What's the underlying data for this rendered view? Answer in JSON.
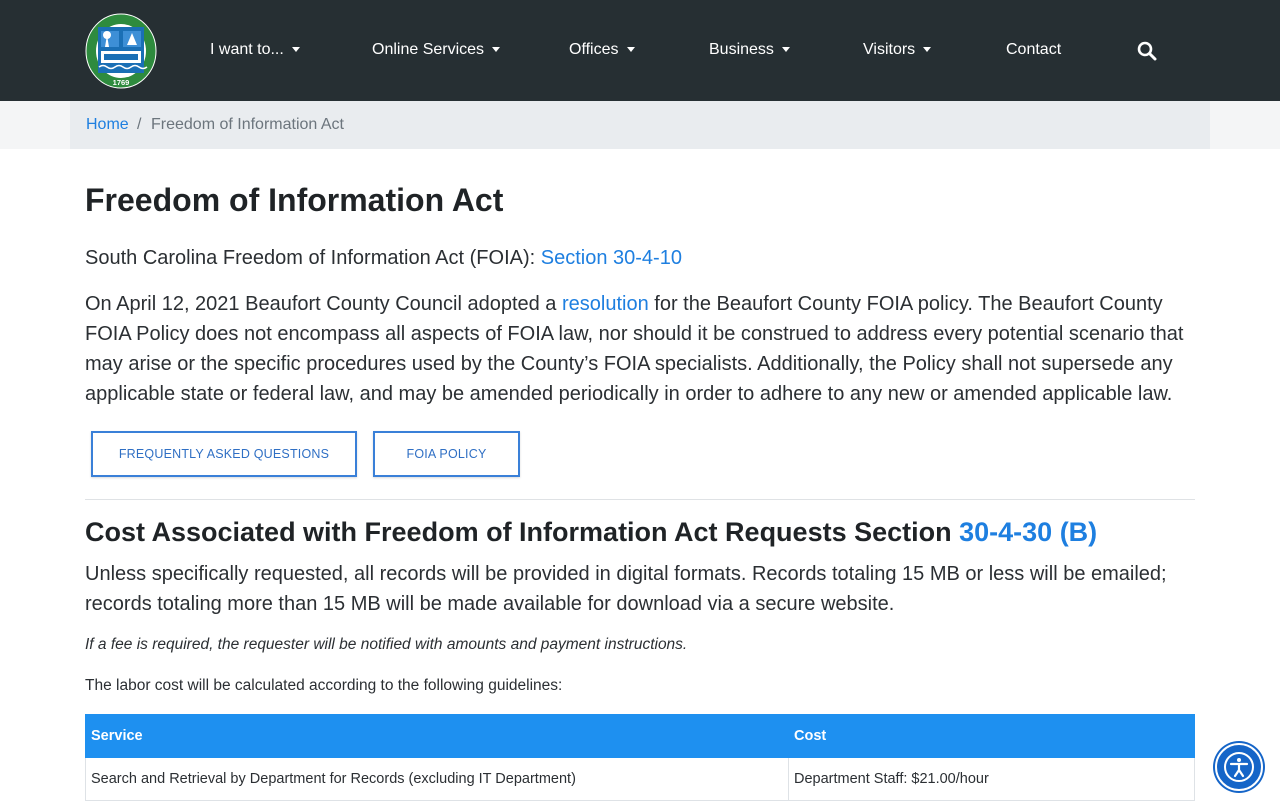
{
  "header": {
    "logo_text": {
      "top": "BEAUFORT COUNTY SOUTH CAROLINA",
      "year": "1769"
    },
    "nav": [
      {
        "label": "I want to...",
        "dropdown": true
      },
      {
        "label": "Online Services",
        "dropdown": true
      },
      {
        "label": "Offices",
        "dropdown": true
      },
      {
        "label": "Business",
        "dropdown": true
      },
      {
        "label": "Visitors",
        "dropdown": true
      },
      {
        "label": "Contact",
        "dropdown": false
      }
    ],
    "search_icon": "search-icon"
  },
  "breadcrumb": {
    "home": "Home",
    "separator": "/",
    "current": "Freedom of Information Act"
  },
  "main": {
    "title": "Freedom of Information Act",
    "foia_line": {
      "text": "South Carolina Freedom of Information Act (FOIA): ",
      "link": "Section 30-4-10"
    },
    "intro": {
      "before": "On April 12, 2021 Beaufort County Council adopted a ",
      "link": "resolution",
      "after": " for the Beaufort County FOIA policy. The Beaufort County FOIA Policy does not encompass all aspects of FOIA law, nor should it be construed to address every potential scenario that may arise or the specific procedures used by the County’s FOIA specialists.  Additionally, the Policy shall not supersede any applicable state or federal law, and may be amended periodically in order to adhere to any new or amended applicable law."
    },
    "buttons": {
      "faq": "FREQUENTLY ASKED QUESTIONS",
      "policy": "FOIA POLICY"
    },
    "cost_heading": {
      "text": "Cost Associated with Freedom of Information Act Requests Section ",
      "link": "30-4-30 (B)"
    },
    "cost_paragraph": "Unless specifically requested, all records will be provided in digital formats. Records totaling 15 MB or less will be emailed; records totaling more than 15 MB will be made available for download via a secure website.",
    "fee_note": "If a fee is required, the requester will be notified with amounts and payment instructions.",
    "labor_note": "The labor cost will be calculated according to the following guidelines:",
    "table": {
      "headers": [
        "Service",
        "Cost"
      ],
      "rows": [
        [
          "Search and Retrieval by Department for Records (excluding IT Department)",
          "Department Staff: $21.00/hour"
        ]
      ]
    }
  },
  "colors": {
    "header_bg": "#262f33",
    "link": "#1e7fe0",
    "table_header": "#1e90f0",
    "accessibility_button": "#1565c8"
  },
  "accessibility_icon": "accessibility-icon"
}
